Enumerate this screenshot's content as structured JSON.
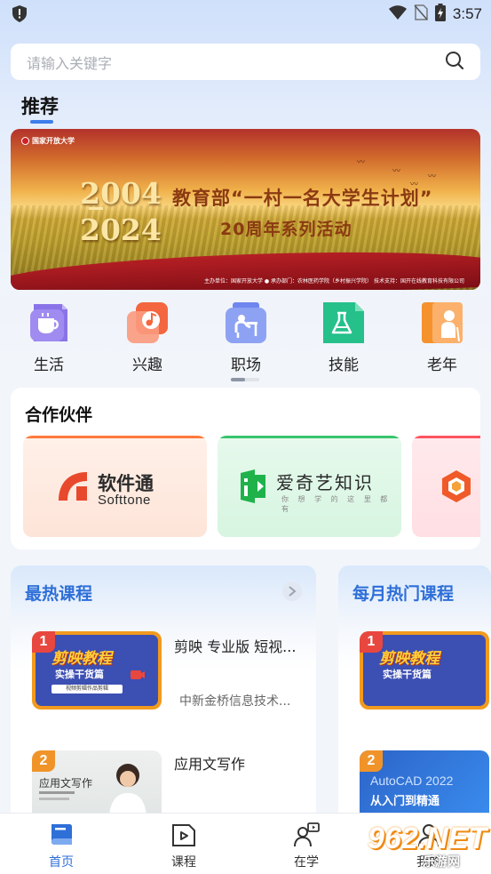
{
  "status_bar": {
    "time": "3:57"
  },
  "search": {
    "placeholder": "请输入关键字"
  },
  "section": {
    "recommend": "推荐"
  },
  "banner": {
    "logo": "国家开放大学",
    "year_start": "2004",
    "year_end": "2024",
    "headline": "教育部“一村一名大学生计划”",
    "subhead": "20周年系列活动",
    "footer": "主办单位：国家开放大学  ●  承办部门：农林医药学院（乡村振兴学院）    技术支持：国开在线教育科技有限公司"
  },
  "categories": [
    {
      "label": "生活",
      "icon": "coffee-cup-icon",
      "color": "#8a73e8"
    },
    {
      "label": "兴趣",
      "icon": "music-note-icon",
      "color": "#f4663f"
    },
    {
      "label": "职场",
      "icon": "office-worker-icon",
      "color": "#6f86ee"
    },
    {
      "label": "技能",
      "icon": "flask-icon",
      "color": "#26c08a"
    },
    {
      "label": "老年",
      "icon": "elderly-person-icon",
      "color": "#f5922e"
    }
  ],
  "partners": {
    "title": "合作伙伴",
    "items": [
      {
        "name_cn": "软件通",
        "name_en": "Softtone"
      },
      {
        "name_cn": "爱奇艺知识",
        "tagline": "你 想 学 的  这 里 都 有"
      },
      {
        "name_cn": ""
      }
    ]
  },
  "hot_courses": {
    "title": "最热课程",
    "items": [
      {
        "rank": "1",
        "name": "剪映 专业版 短视...",
        "org": "中新金桥信息技术...",
        "thumb_title": "剪映教程",
        "thumb_sub": "实操干货篇",
        "thumb_tag": "视频剪辑作品剪辑"
      },
      {
        "rank": "2",
        "name": "应用文写作",
        "thumb_title": "应用文写作"
      }
    ]
  },
  "monthly_courses": {
    "title": "每月热门课程",
    "items": [
      {
        "rank": "1",
        "thumb_title": "剪映教程",
        "thumb_sub": "实操干货篇"
      },
      {
        "rank": "2",
        "thumb_title": "AutoCAD 2022",
        "thumb_sub": "从入门到精通"
      }
    ]
  },
  "bottom_nav": [
    {
      "label": "首页",
      "icon": "home-book-icon",
      "active": true
    },
    {
      "label": "课程",
      "icon": "video-course-icon",
      "active": false
    },
    {
      "label": "在学",
      "icon": "learning-person-icon",
      "active": false
    },
    {
      "label": "我的",
      "icon": "profile-icon",
      "active": false
    }
  ],
  "watermark": {
    "number": "962.NET",
    "site": "乐游网"
  }
}
